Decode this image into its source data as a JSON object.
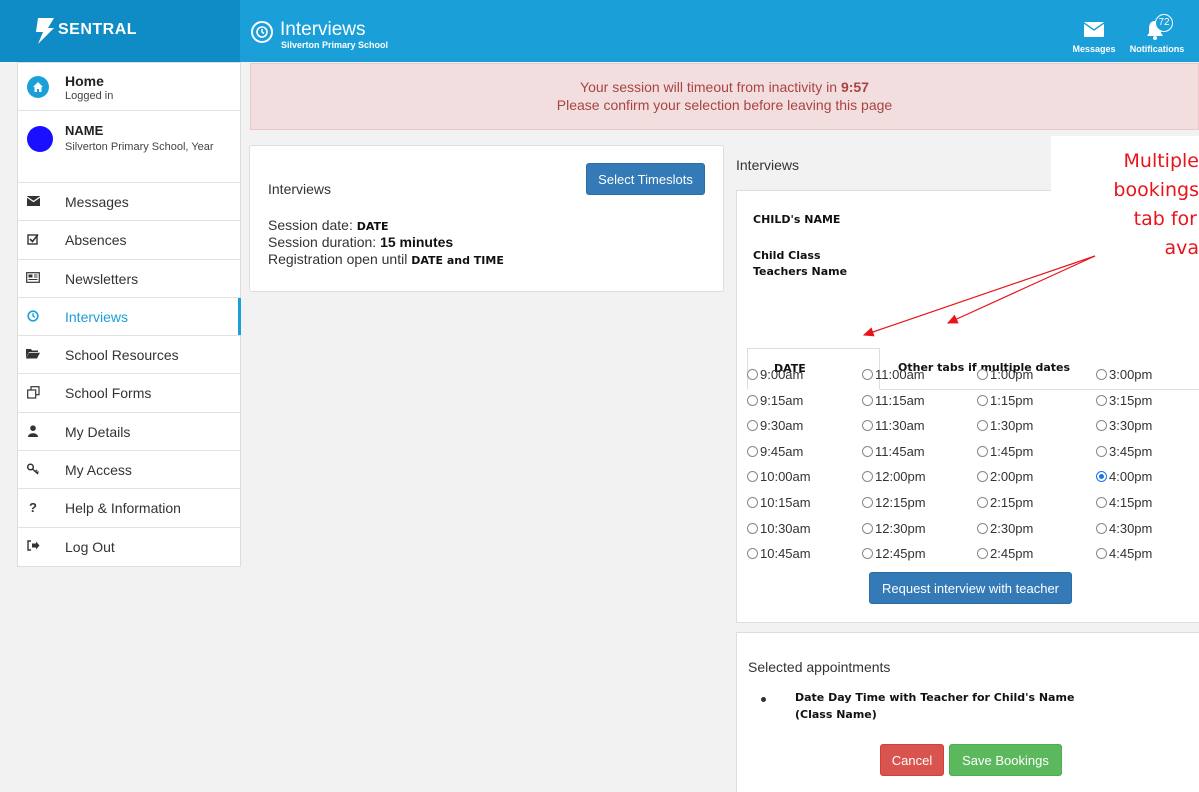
{
  "topbar": {
    "brand": "SENTRAL",
    "title": "Interviews",
    "subtitle": "Silverton Primary School",
    "messages_label": "Messages",
    "notifications_label": "Notifications",
    "notifications_count": "72"
  },
  "sidebar": {
    "home": {
      "title": "Home",
      "subtitle": "Logged in"
    },
    "profile": {
      "name": "NAME",
      "school": "Silverton Primary School, Year"
    },
    "items": [
      {
        "label": "Messages",
        "icon": "envelope-icon"
      },
      {
        "label": "Absences",
        "icon": "checkbox-icon"
      },
      {
        "label": "Newsletters",
        "icon": "newspaper-icon"
      },
      {
        "label": "Interviews",
        "icon": "clock-icon"
      },
      {
        "label": "School Resources",
        "icon": "folder-icon"
      },
      {
        "label": "School Forms",
        "icon": "copy-icon"
      },
      {
        "label": "My Details",
        "icon": "user-icon"
      },
      {
        "label": "My Access",
        "icon": "key-icon"
      },
      {
        "label": "Help & Information",
        "icon": "question-icon"
      },
      {
        "label": "Log Out",
        "icon": "logout-icon"
      }
    ],
    "active_item": "Interviews"
  },
  "banner": {
    "line1_prefix": "Your session will timeout from inactivity in ",
    "countdown": "9:57",
    "line2": "Please confirm your selection before leaving this page"
  },
  "session": {
    "title": "Interviews",
    "select_button": "Select Timeslots",
    "date_label": "Session date: ",
    "date_value": "DATE",
    "duration_label": "Session duration: ",
    "duration_value": "15 minutes",
    "registration_label": "Registration open until ",
    "registration_value": "DATE and TIME"
  },
  "booking": {
    "heading": "Interviews",
    "child_name": "CHILD's NAME",
    "child_class": "Child Class",
    "teacher_name": "Teachers Name",
    "tabs": [
      {
        "label": "DATE",
        "active": true
      },
      {
        "label": "Other tabs if multiple dates",
        "active": false
      }
    ],
    "slots": [
      [
        "9:00am",
        "11:00am",
        "1:00pm",
        "3:00pm"
      ],
      [
        "9:15am",
        "11:15am",
        "1:15pm",
        "3:15pm"
      ],
      [
        "9:30am",
        "11:30am",
        "1:30pm",
        "3:30pm"
      ],
      [
        "9:45am",
        "11:45am",
        "1:45pm",
        "3:45pm"
      ],
      [
        "10:00am",
        "12:00pm",
        "2:00pm",
        "4:00pm"
      ],
      [
        "10:15am",
        "12:15pm",
        "2:15pm",
        "4:15pm"
      ],
      [
        "10:30am",
        "12:30pm",
        "2:30pm",
        "4:30pm"
      ],
      [
        "10:45am",
        "12:45pm",
        "2:45pm",
        "4:45pm"
      ]
    ],
    "selected_slot": "4:00pm",
    "request_button": "Request interview with teacher"
  },
  "selected": {
    "title": "Selected appointments",
    "line1": "Date Day Time with Teacher for Child's Name",
    "line2": "(Class Name)",
    "cancel_button": "Cancel",
    "save_button": "Save Bookings"
  },
  "annotation": {
    "lines": [
      "Multiple",
      "bookings",
      "tab for",
      "ava"
    ],
    "color": "#e8141b"
  }
}
